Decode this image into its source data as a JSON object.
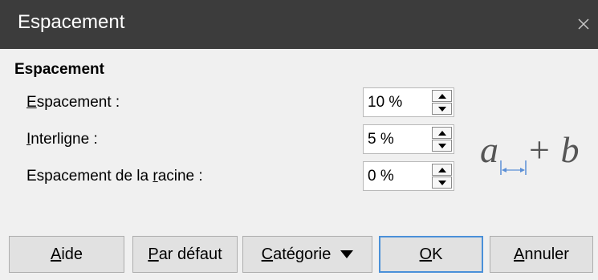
{
  "window": {
    "title": "Espacement",
    "close_icon": "close-icon"
  },
  "section": {
    "title": "Espacement"
  },
  "fields": [
    {
      "label_key": "E",
      "label_rest": "spacement :",
      "value": "10 %"
    },
    {
      "label_key": "I",
      "label_rest": "nterligne :",
      "value": "5 %"
    },
    {
      "label_pre": "Espacement de la ",
      "label_key": "r",
      "label_rest": "acine :",
      "value": "0 %"
    }
  ],
  "preview": {
    "formula_a": "a",
    "formula_rest": "+ b"
  },
  "buttons": {
    "help_key": "A",
    "help_rest": "ide",
    "default_key": "P",
    "default_rest": "ar défaut",
    "category_key": "C",
    "category_rest": "atégorie",
    "ok_key": "O",
    "ok_rest": "K",
    "cancel_key": "A",
    "cancel_rest": "nnuler"
  }
}
